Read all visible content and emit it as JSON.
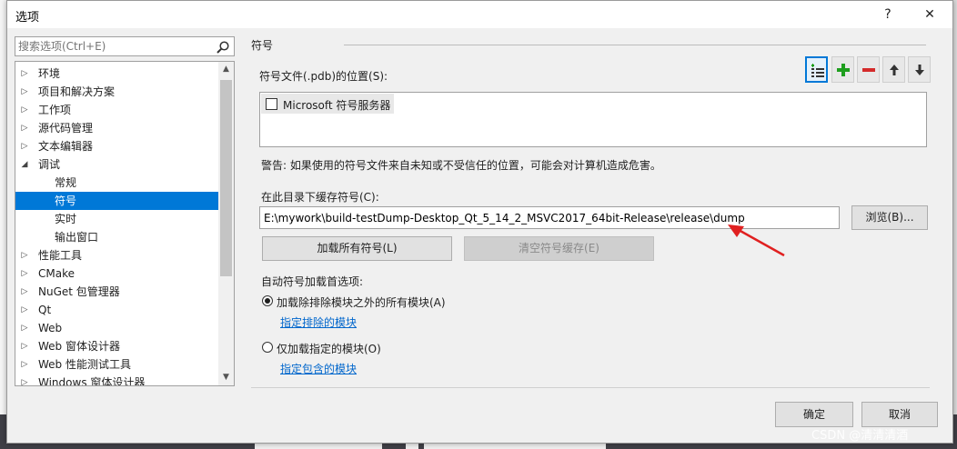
{
  "dialog": {
    "title": "选项",
    "help_button": "?",
    "close_button": "✕"
  },
  "search": {
    "placeholder": "搜索选项(Ctrl+E)"
  },
  "tree": {
    "items": [
      {
        "label": "环境",
        "level": 0,
        "expander": "collapsed"
      },
      {
        "label": "项目和解决方案",
        "level": 0,
        "expander": "collapsed"
      },
      {
        "label": "工作项",
        "level": 0,
        "expander": "collapsed"
      },
      {
        "label": "源代码管理",
        "level": 0,
        "expander": "collapsed"
      },
      {
        "label": "文本编辑器",
        "level": 0,
        "expander": "collapsed"
      },
      {
        "label": "调试",
        "level": 0,
        "expander": "expanded"
      },
      {
        "label": "常规",
        "level": 1,
        "expander": "none"
      },
      {
        "label": "符号",
        "level": 1,
        "expander": "none",
        "selected": true
      },
      {
        "label": "实时",
        "level": 1,
        "expander": "none"
      },
      {
        "label": "输出窗口",
        "level": 1,
        "expander": "none"
      },
      {
        "label": "性能工具",
        "level": 0,
        "expander": "collapsed"
      },
      {
        "label": "CMake",
        "level": 0,
        "expander": "collapsed"
      },
      {
        "label": "NuGet 包管理器",
        "level": 0,
        "expander": "collapsed"
      },
      {
        "label": "Qt",
        "level": 0,
        "expander": "collapsed"
      },
      {
        "label": "Web",
        "level": 0,
        "expander": "collapsed"
      },
      {
        "label": "Web 窗体设计器",
        "level": 0,
        "expander": "collapsed"
      },
      {
        "label": "Web 性能测试工具",
        "level": 0,
        "expander": "collapsed"
      },
      {
        "label": "Windows 窗体设计器",
        "level": 0,
        "expander": "collapsed"
      }
    ]
  },
  "symbols": {
    "section_title": "符号",
    "locations_label": "符号文件(.pdb)的位置(S):",
    "servers": [
      {
        "label": "Microsoft 符号服务器",
        "checked": false
      }
    ],
    "warning": "警告: 如果使用的符号文件来自未知或不受信任的位置，可能会对计算机造成危害。",
    "cache_label": "在此目录下缓存符号(C):",
    "cache_path": "E:\\mywork\\build-testDump-Desktop_Qt_5_14_2_MSVC2017_64bit-Release\\release\\dump",
    "browse_button": "浏览(B)...",
    "load_all_button": "加载所有符号(L)",
    "clear_cache_button": "清空符号缓存(E)",
    "auto_load_label": "自动符号加载首选项:",
    "option_all_label": "加载除排除模块之外的所有模块(A)",
    "option_all_checked": true,
    "specify_excluded_link": "指定排除的模块",
    "option_specified_label": "仅加载指定的模块(O)",
    "option_specified_checked": false,
    "specify_included_link": "指定包含的模块"
  },
  "footer": {
    "ok_button": "确定",
    "cancel_button": "取消"
  },
  "watermark": "CSDN @清清清酒",
  "colors": {
    "selection": "#0078d7",
    "link": "#0066cc",
    "add_green": "#1e9e1e",
    "remove_red": "#d42b2b",
    "arrow_annotation": "#e02020"
  }
}
